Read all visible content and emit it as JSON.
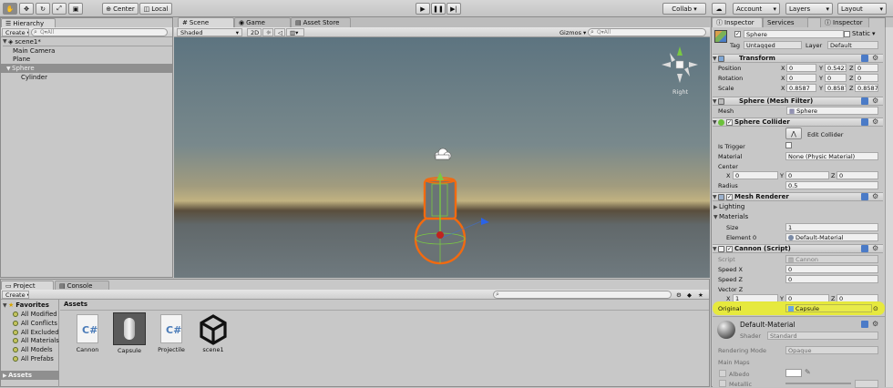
{
  "toolbar": {
    "pivot_label": "Center",
    "space_label": "Local",
    "collab_label": "Collab ▾",
    "account_label": "Account",
    "layers_label": "Layers",
    "layout_label": "Layout"
  },
  "hierarchy": {
    "tab_label": "Hierarchy",
    "create_label": "Create ▾",
    "search_placeholder": "Q▾All",
    "scene_name": "scene1*",
    "items": [
      {
        "label": "Main Camera"
      },
      {
        "label": "Plane"
      },
      {
        "label": "Sphere"
      },
      {
        "label": "Cylinder"
      }
    ]
  },
  "scene_view": {
    "tabs": [
      {
        "label": "Scene"
      },
      {
        "label": "Game"
      },
      {
        "label": "Asset Store"
      }
    ],
    "shading_mode": "Shaded",
    "mode_2d": "2D",
    "gizmos_label": "Gizmos ▾",
    "search_placeholder": "Q▾All",
    "gizmo_view_label": "Right"
  },
  "project": {
    "tabs": [
      {
        "label": "Project"
      },
      {
        "label": "Console"
      }
    ],
    "create_label": "Create ▾",
    "favorites_label": "Favorites",
    "favorites": [
      {
        "label": "All Modified"
      },
      {
        "label": "All Conflicts"
      },
      {
        "label": "All Excluded"
      },
      {
        "label": "All Materials"
      },
      {
        "label": "All Models"
      },
      {
        "label": "All Prefabs"
      }
    ],
    "assets_folder_label": "Assets",
    "breadcrumb": "Assets",
    "assets": [
      {
        "name": "Cannon"
      },
      {
        "name": "Capsule"
      },
      {
        "name": "Projectile"
      },
      {
        "name": "scene1"
      }
    ]
  },
  "inspector": {
    "tabs": [
      {
        "label": "Inspector"
      },
      {
        "label": "Services"
      }
    ],
    "second_tab": "Inspector",
    "object_name": "Sphere",
    "static_label": "Static",
    "tag_label": "Tag",
    "tag_value": "Untagged",
    "layer_label": "Layer",
    "layer_value": "Default",
    "transform": {
      "title": "Transform",
      "position_label": "Position",
      "rotation_label": "Rotation",
      "scale_label": "Scale",
      "position": {
        "x": "0",
        "y": "0.5421",
        "z": "0"
      },
      "rotation": {
        "x": "0",
        "y": "0",
        "z": "0"
      },
      "scale": {
        "x": "0.8587",
        "y": "0.8587",
        "z": "0.8587"
      }
    },
    "mesh_filter": {
      "title": "Sphere (Mesh Filter)",
      "mesh_label": "Mesh",
      "mesh_value": "Sphere"
    },
    "sphere_collider": {
      "title": "Sphere Collider",
      "edit_label": "Edit Collider",
      "is_trigger_label": "Is Trigger",
      "material_label": "Material",
      "material_value": "None (Physic Material)",
      "center_label": "Center",
      "center": {
        "x": "0",
        "y": "0",
        "z": "0"
      },
      "radius_label": "Radius",
      "radius_value": "0.5"
    },
    "mesh_renderer": {
      "title": "Mesh Renderer",
      "lighting_label": "Lighting",
      "materials_label": "Materials",
      "size_label": "Size",
      "size_value": "1",
      "element_label": "Element 0",
      "element_value": "Default-Material"
    },
    "cannon_script": {
      "title": "Cannon (Script)",
      "script_label": "Script",
      "script_value": "Cannon",
      "speed_x_label": "Speed X",
      "speed_x_value": "0",
      "speed_z_label": "Speed Z",
      "speed_z_value": "0",
      "vector_z_label": "Vector Z",
      "vector_z": {
        "x": "1",
        "y": "0",
        "z": "0"
      },
      "original_label": "Original",
      "original_value": "Capsule"
    },
    "material": {
      "name": "Default-Material",
      "shader_label": "Shader",
      "shader_value": "Standard",
      "rendering_mode_label": "Rendering Mode",
      "rendering_mode_value": "Opaque",
      "main_maps_label": "Main Maps",
      "albedo_label": "Albedo",
      "metallic_label": "Metallic"
    }
  },
  "colors": {
    "highlight": "#e9ec2f",
    "selection_orange": "#f26a10",
    "gizmo_green": "#7ac943",
    "sky_top": "#5f7682",
    "horizon": "#5b4f3e"
  }
}
